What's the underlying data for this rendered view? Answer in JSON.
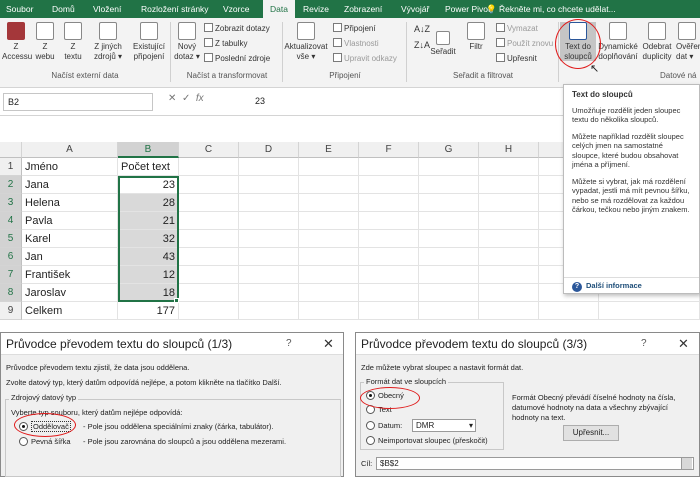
{
  "tabs": [
    "Soubor",
    "Domů",
    "Vložení",
    "Rozložení stránky",
    "Vzorce",
    "Data",
    "Revize",
    "Zobrazení",
    "Vývojář",
    "Power Pivot"
  ],
  "tell_me": "Řekněte mi, co chcete udělat...",
  "ribbon": {
    "ext": {
      "access": "Z\nAccessu",
      "web": "Z\nwebu",
      "text": "Z\ntextu",
      "other": "Z jiných\nzdrojů ▾",
      "existing": "Existující\npřipojení",
      "group": "Načíst externí data"
    },
    "transform": {
      "new_query": "Nový\ndotaz ▾",
      "show": "Zobrazit dotazy",
      "table": "Z tabulky",
      "recent": "Poslední zdroje",
      "group": "Načíst a transformovat"
    },
    "conn": {
      "refresh": "Aktualizovat\nvše ▾",
      "connections": "Připojení",
      "properties": "Vlastnosti",
      "edit": "Upravit odkazy",
      "group": "Připojení"
    },
    "sort": {
      "sort": "Seřadit",
      "filter": "Filtr",
      "clear": "Vymazat",
      "reapply": "Použít znovu",
      "advanced": "Upřesnit",
      "group": "Seřadit a filtrovat"
    },
    "tools": {
      "text_to_cols": "Text do\nsloupců",
      "flash": "Dynamické\ndoplňování",
      "remove_dup": "Odebrat\nduplicity",
      "validate": "Ověření\ndat ▾",
      "group": "Datové ná"
    }
  },
  "formula": {
    "namebox": "B2",
    "value": "23",
    "fx": "fx"
  },
  "columns": [
    "A",
    "B",
    "C",
    "D",
    "E",
    "F",
    "G",
    "H",
    "I",
    "J"
  ],
  "rows": [
    {
      "n": "1",
      "a": "Jméno",
      "b": "Počet text"
    },
    {
      "n": "2",
      "a": "Jana",
      "b": "23"
    },
    {
      "n": "3",
      "a": "Helena",
      "b": "28"
    },
    {
      "n": "4",
      "a": "Pavla",
      "b": "21"
    },
    {
      "n": "5",
      "a": "Karel",
      "b": "32"
    },
    {
      "n": "6",
      "a": "Jan",
      "b": "43"
    },
    {
      "n": "7",
      "a": "František",
      "b": "12"
    },
    {
      "n": "8",
      "a": "Jaroslav",
      "b": "18"
    },
    {
      "n": "9",
      "a": "Celkem",
      "b": "177"
    }
  ],
  "tooltip": {
    "title": "Text do sloupců",
    "p1": "Umožňuje rozdělit jeden sloupec textu do několika sloupců.",
    "p2": "Můžete například rozdělit sloupec celých jmen na samostatné sloupce, které budou obsahovat jména a příjmení.",
    "p3": "Můžete si vybrat, jak má rozdělení vypadat, jestli má mít pevnou šířku, nebo se má rozdělovat za každou čárkou, tečkou nebo jiným znakem.",
    "more": "Další informace"
  },
  "wizard1": {
    "title": "Průvodce převodem textu do sloupců (1/3)",
    "help": "?",
    "close": "✕",
    "l1": "Průvodce převodem textu zjistil, že data jsou oddělena.",
    "l2": "Zvolte datový typ, který datům odpovídá nejlépe, a potom klikněte na tlačítko Další.",
    "group": "Zdrojový datový typ",
    "l3": "Vyberte typ souboru, který datům nejlépe odpovídá:",
    "opt1": "Oddělovač",
    "opt1_desc": "- Pole jsou oddělena speciálními znaky (čárka, tabulátor).",
    "opt2": "Pevná šířka",
    "opt2_desc": "- Pole jsou zarovnána do sloupců a jsou oddělena mezerami."
  },
  "wizard3": {
    "title": "Průvodce převodem textu do sloupců (3/3)",
    "help": "?",
    "close": "✕",
    "l1": "Zde můžete vybrat sloupec a nastavit formát dat.",
    "group": "Formát dat ve sloupcích",
    "opt1": "Obecný",
    "opt2": "Text",
    "opt3": "Datum:",
    "date_fmt": "DMR",
    "opt4": "Neimportovat sloupec (přeskočit)",
    "desc": "Formát Obecný převádí číselné hodnoty na čísla, datumové hodnoty na data a všechny zbývající hodnoty na text.",
    "adv": "Upřesnit...",
    "dest_label": "Cíl:",
    "dest_value": "$B$2"
  },
  "colors": {
    "excel_green": "#217346",
    "highlight": "#d9d9d9",
    "annotation": "#e01b1b"
  }
}
